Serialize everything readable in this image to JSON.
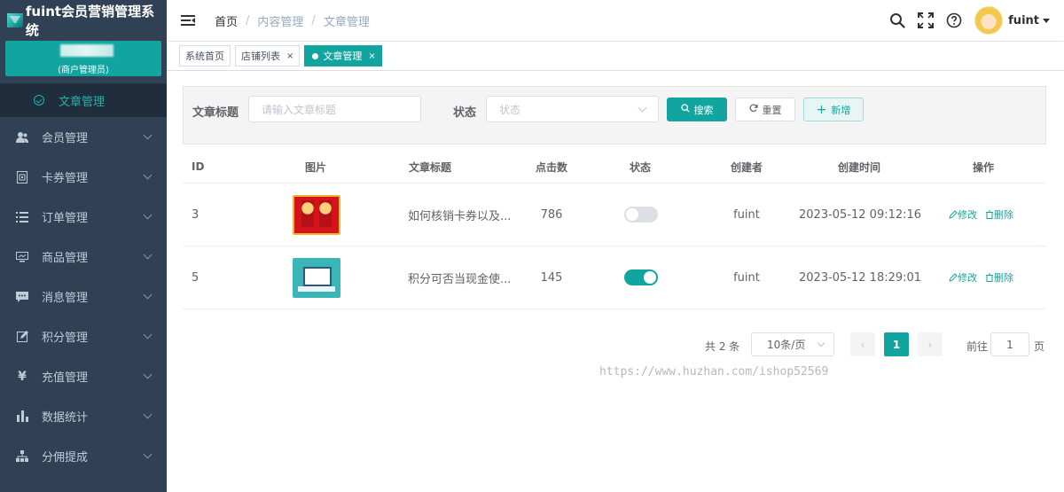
{
  "app": {
    "title": "fuint会员营销管理系统",
    "merchant_role": "(商户管理员)",
    "accent_color": "#12a5a0",
    "sidebar_bg": "#304156"
  },
  "sidebar": {
    "active_sub": {
      "label": "文章管理",
      "icon": "check-circle-icon"
    },
    "items": [
      {
        "label": "会员管理",
        "icon": "users-icon"
      },
      {
        "label": "卡券管理",
        "icon": "coupon-icon"
      },
      {
        "label": "订单管理",
        "icon": "list-icon"
      },
      {
        "label": "商品管理",
        "icon": "monitor-icon"
      },
      {
        "label": "消息管理",
        "icon": "message-icon"
      },
      {
        "label": "积分管理",
        "icon": "edit-icon"
      },
      {
        "label": "充值管理",
        "icon": "yen-icon"
      },
      {
        "label": "数据统计",
        "icon": "bar-chart-icon"
      },
      {
        "label": "分佣提成",
        "icon": "tree-icon"
      }
    ]
  },
  "header": {
    "breadcrumb": [
      "首页",
      "内容管理",
      "文章管理"
    ],
    "username": "fuint"
  },
  "tags": [
    {
      "label": "系统首页"
    },
    {
      "label": "店铺列表",
      "close": "×"
    },
    {
      "label": "文章管理",
      "close": "×",
      "active": true
    }
  ],
  "filter": {
    "title_label": "文章标题",
    "title_placeholder": "请输入文章标题",
    "status_label": "状态",
    "status_placeholder": "状态",
    "search_label": "搜索",
    "reset_label": "重置",
    "add_label": "新增"
  },
  "table": {
    "columns": [
      "ID",
      "图片",
      "文章标题",
      "点击数",
      "状态",
      "创建者",
      "创建时间",
      "操作"
    ],
    "rows": [
      {
        "id": "3",
        "title": "如何核销卡券以及...",
        "clicks": "786",
        "status_on": false,
        "creator": "fuint",
        "created": "2023-05-12 09:12:16"
      },
      {
        "id": "5",
        "title": "积分可否当现金使...",
        "clicks": "145",
        "status_on": true,
        "creator": "fuint",
        "created": "2023-05-12 18:29:01"
      }
    ],
    "edit_label": "修改",
    "delete_label": "删除"
  },
  "pagination": {
    "total_text": "共 2 条",
    "page_size": "10条/页",
    "prev": "‹",
    "current_page": "1",
    "next": "›",
    "goto_label": "前往",
    "goto_value": "1",
    "goto_suffix": "页"
  },
  "watermark": "https://www.huzhan.com/ishop52569"
}
